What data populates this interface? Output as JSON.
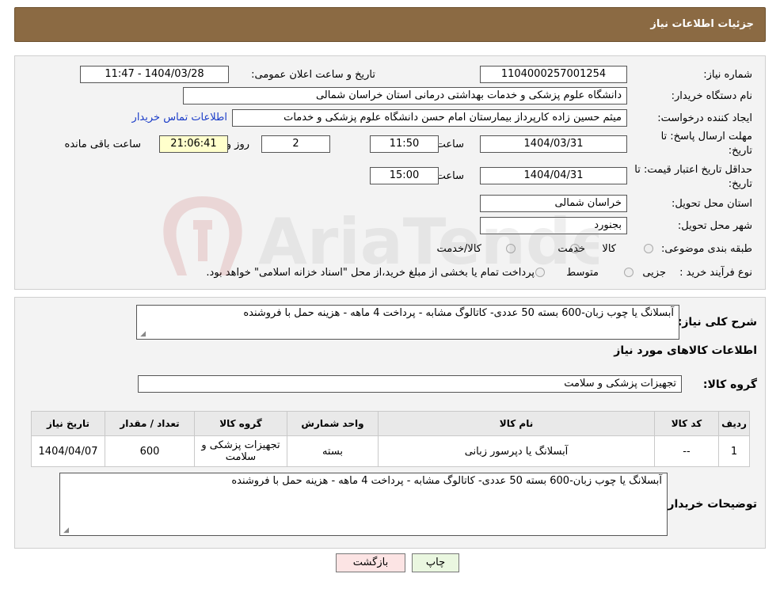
{
  "header": {
    "title": "جزئیات اطلاعات نیاز"
  },
  "form": {
    "need_number_label": "شماره نیاز:",
    "need_number": "1104000257001254",
    "announce_label": "تاریخ و ساعت اعلان عمومی:",
    "announce_value": "1404/03/28 - 11:47",
    "buyer_org_label": "نام دستگاه خریدار:",
    "buyer_org": "دانشگاه علوم پزشکی و خدمات بهداشتی درمانی استان خراسان شمالی",
    "creator_label": "ایجاد کننده درخواست:",
    "creator": "میثم  حسین زاده  کارپرداز بیمارستان امام حسن دانشگاه علوم پزشکی و خدمات",
    "contact_link": "اطلاعات تماس خریدار",
    "deadline_label_1": "مهلت ارسال پاسخ: تا",
    "deadline_label_2": "تاریخ:",
    "deadline_date": "1404/03/31",
    "time_label": "ساعت",
    "deadline_time": "11:50",
    "days_value": "2",
    "days_label": "روز و",
    "remaining_time": "21:06:41",
    "remaining_label": "ساعت باقی مانده",
    "validity_label_1": "حداقل تاریخ اعتبار قیمت: تا",
    "validity_label_2": "تاریخ:",
    "validity_date": "1404/04/31",
    "validity_time": "15:00",
    "province_label": "استان محل تحویل:",
    "province": "خراسان شمالی",
    "city_label": "شهر محل تحویل:",
    "city": "بجنورد",
    "category_label": "طبقه بندی موضوعی:",
    "category_options": [
      "کالا",
      "خدمت",
      "کالا/خدمت"
    ],
    "process_label": "نوع فرآیند خرید :",
    "process_options": [
      "جزیی",
      "متوسط"
    ],
    "process_note": "پرداخت تمام یا بخشی از مبلغ خرید،از محل \"اسناد خزانه اسلامی\" خواهد بود."
  },
  "details": {
    "description_label": "شرح کلی نیاز:",
    "description": "آبسلانگ یا چوب زبان-600 بسته 50 عددی- کاتالوگ مشابه - پرداخت 4 ماهه - هزینه حمل با فروشنده",
    "items_heading": "اطلاعات کالاهای مورد نیاز",
    "group_label": "گروه کالا:",
    "group_value": "تجهیزات پزشکی و سلامت",
    "table": {
      "headers": [
        "ردیف",
        "کد کالا",
        "نام کالا",
        "واحد شمارش",
        "گروه کالا",
        "تعداد / مقدار",
        "تاریخ نیاز"
      ],
      "rows": [
        [
          "1",
          "--",
          "آبسلانگ یا دپرسور زبانی",
          "بسته",
          "تجهیزات پزشکی و سلامت",
          "600",
          "1404/04/07"
        ]
      ]
    },
    "buyer_notes_label": "توضیحات خریدار:",
    "buyer_notes": "آبسلانگ یا چوب زبان-600 بسته 50 عددی- کاتالوگ مشابه - پرداخت 4 ماهه - هزینه حمل با فروشنده"
  },
  "buttons": {
    "print": "چاپ",
    "back": "بازگشت"
  },
  "watermark": {
    "text": "AriaTender.neT"
  },
  "colors": {
    "header_bg": "#8b6a43",
    "link": "#1a3cc8",
    "back_button": "#fce4e4",
    "print_button": "#eaf7e0"
  }
}
